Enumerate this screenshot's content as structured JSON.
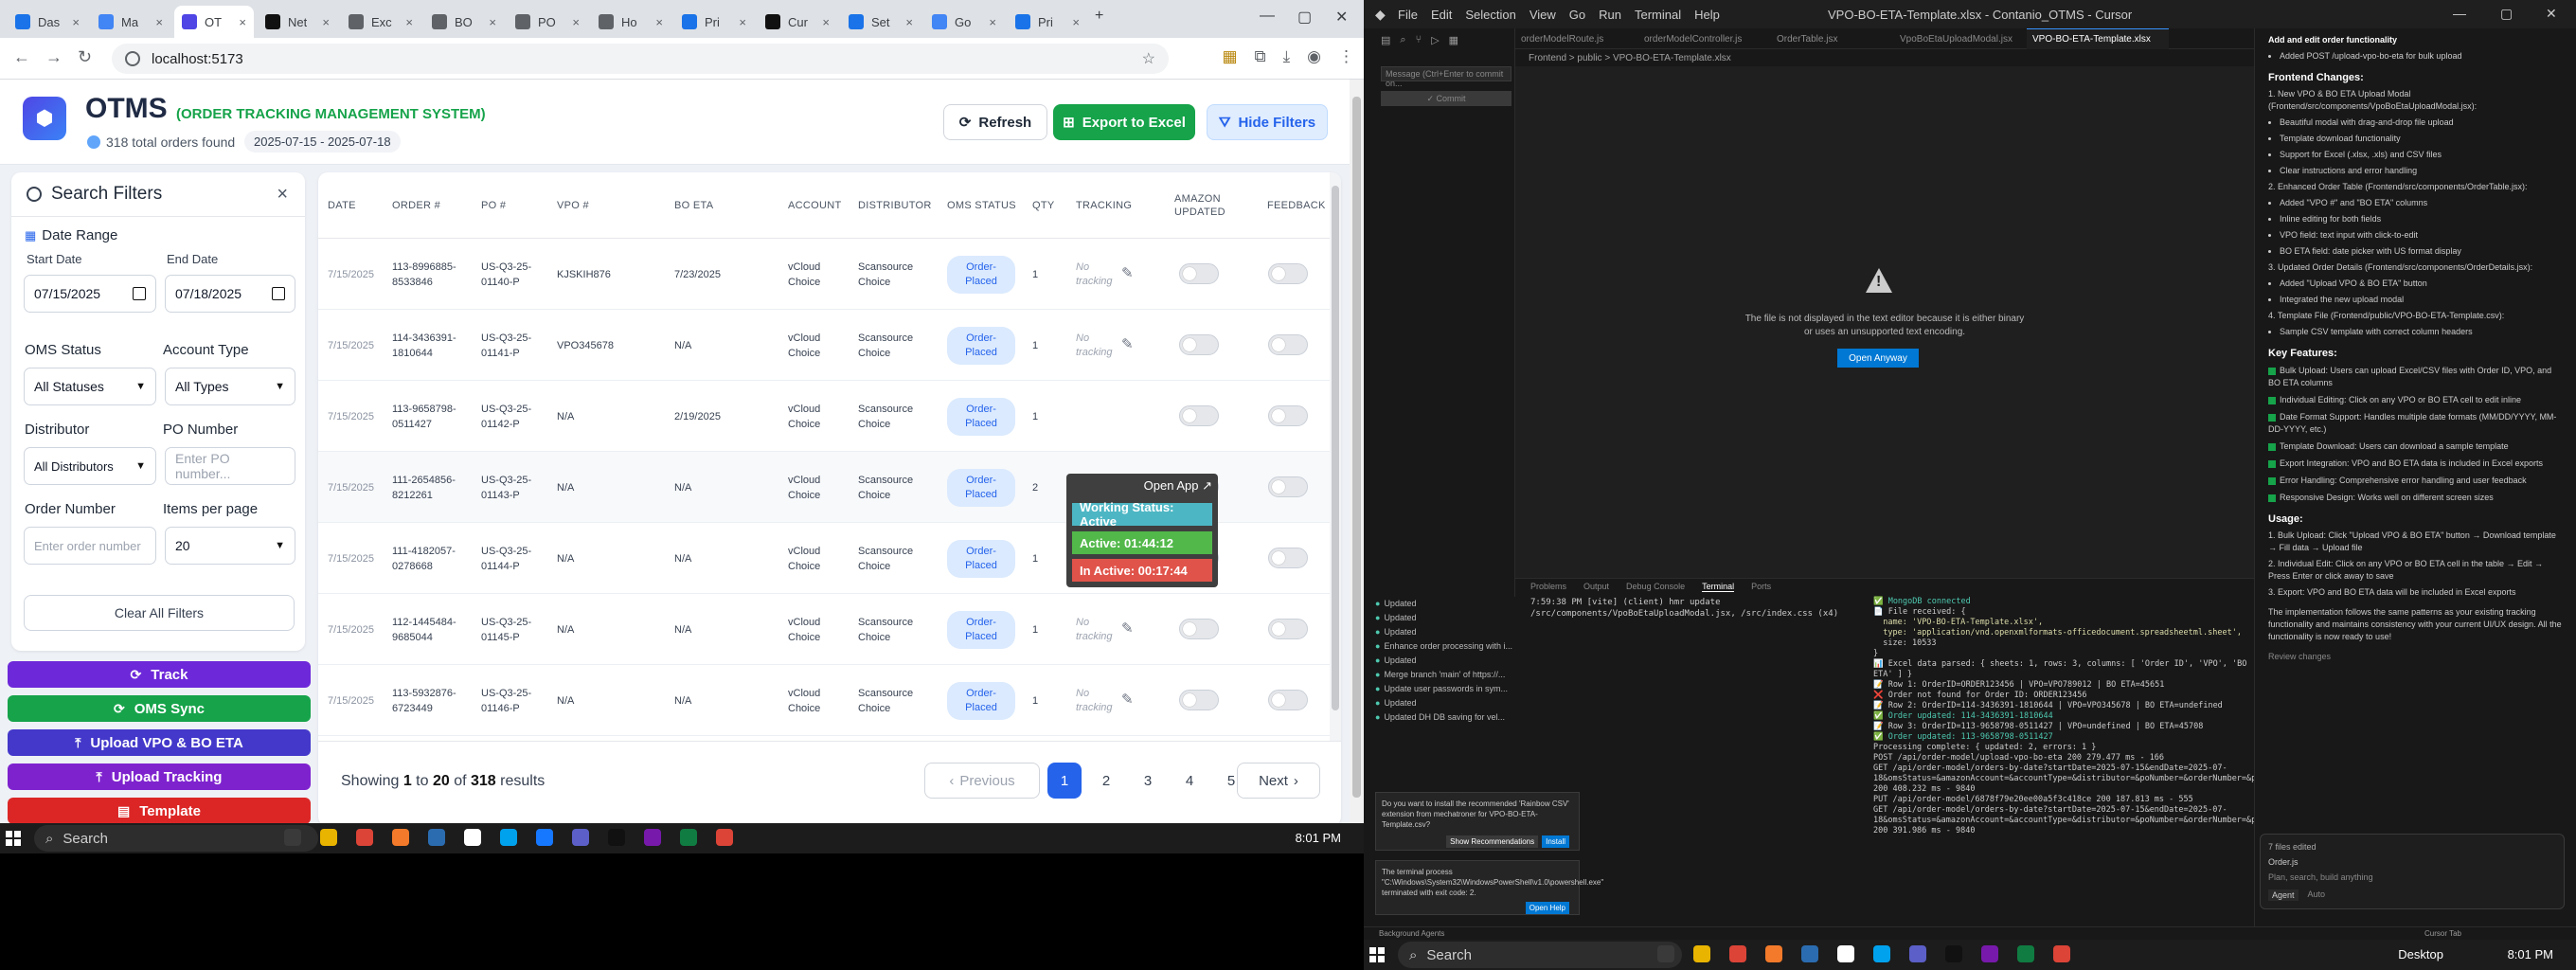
{
  "browser": {
    "tabs": [
      {
        "label": "Das",
        "color": "#1a73e8"
      },
      {
        "label": "Ma",
        "color": "#4285f4"
      },
      {
        "label": "OT",
        "color": "#4f46e5"
      },
      {
        "label": "Net",
        "color": "#111111"
      },
      {
        "label": "Exc",
        "color": "#5f6368"
      },
      {
        "label": "BO",
        "color": "#5f6368"
      },
      {
        "label": "PO",
        "color": "#5f6368"
      },
      {
        "label": "Ho",
        "color": "#5f6368"
      },
      {
        "label": "Pri",
        "color": "#1a73e8"
      },
      {
        "label": "Cur",
        "color": "#111111"
      },
      {
        "label": "Set",
        "color": "#1a73e8"
      },
      {
        "label": "Go",
        "color": "#4285f4"
      },
      {
        "label": "Pri",
        "color": "#1a73e8"
      }
    ],
    "url": "localhost:5173"
  },
  "header": {
    "title": "OTMS",
    "subtitle": "(ORDER TRACKING MANAGEMENT SYSTEM)",
    "orders_found": "318 total orders found",
    "date_range": "2025-07-15 - 2025-07-18",
    "refresh": "Refresh",
    "export": "Export to Excel",
    "hide_filters": "Hide Filters"
  },
  "filters": {
    "title": "Search Filters",
    "date_range": "Date Range",
    "start_label": "Start Date",
    "end_label": "End Date",
    "start_value": "07/15/2025",
    "end_value": "07/18/2025",
    "oms_status_label": "OMS Status",
    "oms_status_value": "All Statuses",
    "account_type_label": "Account Type",
    "account_type_value": "All Types",
    "distributor_label": "Distributor",
    "distributor_value": "All Distributors",
    "po_label": "PO Number",
    "po_placeholder": "Enter PO number...",
    "order_label": "Order Number",
    "order_placeholder": "Enter order number",
    "ipp_label": "Items per page",
    "ipp_value": "20",
    "clear": "Clear All Filters"
  },
  "actions": [
    {
      "label": "Track",
      "color": "#6d28d9",
      "icon": "refresh-icon"
    },
    {
      "label": "OMS Sync",
      "color": "#16a34a",
      "icon": "refresh-icon"
    },
    {
      "label": "Upload VPO & BO ETA",
      "color": "#4338ca",
      "icon": "upload-icon"
    },
    {
      "label": "Upload Tracking",
      "color": "#7e22ce",
      "icon": "upload-icon"
    },
    {
      "label": "Template",
      "color": "#dc2626",
      "icon": "file-icon"
    }
  ],
  "table": {
    "columns": [
      "DATE",
      "ORDER #",
      "PO #",
      "VPO #",
      "BO ETA",
      "ACCOUNT",
      "DISTRIBUTOR",
      "OMS STATUS",
      "QTY",
      "TRACKING",
      "AMAZON UPDATED",
      "FEEDBACK"
    ],
    "rows": [
      {
        "date": "7/15/2025",
        "order": "113-8996885-8533846",
        "po": "US-Q3-25-01140-P",
        "vpo": "KJSKIH876",
        "bo_eta": "7/23/2025",
        "account": "vCloud Choice",
        "distributor": "Scansource Choice",
        "status": "Order-Placed",
        "qty": "1",
        "tracking": "No tracking"
      },
      {
        "date": "7/15/2025",
        "order": "114-3436391-1810644",
        "po": "US-Q3-25-01141-P",
        "vpo": "VPO345678",
        "bo_eta": "N/A",
        "account": "vCloud Choice",
        "distributor": "Scansource Choice",
        "status": "Order-Placed",
        "qty": "1",
        "tracking": "No tracking"
      },
      {
        "date": "7/15/2025",
        "order": "113-9658798-0511427",
        "po": "US-Q3-25-01142-P",
        "vpo": "N/A",
        "bo_eta": "2/19/2025",
        "account": "vCloud Choice",
        "distributor": "Scansource Choice",
        "status": "Order-Placed",
        "qty": "1",
        "tracking": ""
      },
      {
        "date": "7/15/2025",
        "order": "111-2654856-8212261",
        "po": "US-Q3-25-01143-P",
        "vpo": "N/A",
        "bo_eta": "N/A",
        "account": "vCloud Choice",
        "distributor": "Scansource Choice",
        "status": "Order-Placed",
        "qty": "2",
        "tracking": ""
      },
      {
        "date": "7/15/2025",
        "order": "111-4182057-0278668",
        "po": "US-Q3-25-01144-P",
        "vpo": "N/A",
        "bo_eta": "N/A",
        "account": "vCloud Choice",
        "distributor": "Scansource Choice",
        "status": "Order-Placed",
        "qty": "1",
        "tracking": "No tracking"
      },
      {
        "date": "7/15/2025",
        "order": "112-1445484-9685044",
        "po": "US-Q3-25-01145-P",
        "vpo": "N/A",
        "bo_eta": "N/A",
        "account": "vCloud Choice",
        "distributor": "Scansource Choice",
        "status": "Order-Placed",
        "qty": "1",
        "tracking": "No tracking"
      },
      {
        "date": "7/15/2025",
        "order": "113-5932876-6723449",
        "po": "US-Q3-25-01146-P",
        "vpo": "N/A",
        "bo_eta": "N/A",
        "account": "vCloud Choice",
        "distributor": "Scansource Choice",
        "status": "Order-Placed",
        "qty": "1",
        "tracking": "No tracking"
      }
    ],
    "showing_prefix": "Showing ",
    "showing_from": "1",
    "showing_to_word": " to ",
    "showing_to": "20",
    "showing_of_word": " of ",
    "showing_total": "318",
    "showing_suffix": " results",
    "prev": "Previous",
    "next": "Next",
    "pages": [
      "1",
      "2",
      "3",
      "4",
      "5"
    ]
  },
  "widget": {
    "open_app": "Open App ↗",
    "working": "Working Status: Active",
    "active": "Active: 01:44:12",
    "inactive": "In Active: 00:17:44"
  },
  "taskbar": {
    "search": "Search",
    "time": "8:01 PM",
    "desktop": "Desktop"
  },
  "vscode": {
    "title": "VPO-BO-ETA-Template.xlsx - Contanio_OTMS - Cursor",
    "menu": [
      "File",
      "Edit",
      "Selection",
      "View",
      "Go",
      "Run",
      "Terminal",
      "Help"
    ],
    "tabs": [
      "orderModelRoute.js",
      "orderModelController.js",
      "OrderTable.jsx",
      "VpoBoEtaUploadModal.jsx",
      "VPO-BO-ETA-Template.xlsx"
    ],
    "breadcrumb": "Frontend > public > VPO-BO-ETA-Template.xlsx",
    "binary_msg": "The file is not displayed in the text editor because it is either binary or uses an unsupported text encoding.",
    "open_anyway": "Open Anyway",
    "message_placeholder": "Message (Ctrl+Enter to commit on...",
    "commit": "✓ Commit",
    "panel_tabs": [
      "Problems",
      "Output",
      "Debug Console",
      "Terminal",
      "Ports"
    ],
    "term_left": "7:59:38 PM [vite] (client) hmr update /src/components/VpoBoEtaUploadModal.jsx, /src/index.css (x4)",
    "term_right": [
      {
        "t": "✅ MongoDB connected",
        "c": "g"
      },
      {
        "t": "📄 File received: {",
        "c": ""
      },
      {
        "t": "  name: 'VPO-BO-ETA-Template.xlsx',",
        "c": "y"
      },
      {
        "t": "  type: 'application/vnd.openxmlformats-officedocument.spreadsheetml.sheet',",
        "c": "y"
      },
      {
        "t": "  size: 10533",
        "c": ""
      },
      {
        "t": "}",
        "c": ""
      },
      {
        "t": "📊 Excel data parsed: { sheets: 1, rows: 3, columns: [ 'Order ID', 'VPO', 'BO ETA' ] }",
        "c": ""
      },
      {
        "t": "📝 Row 1: OrderID=ORDER123456 | VPO=VPO789012 | BO ETA=45651",
        "c": ""
      },
      {
        "t": "❌ Order not found for Order ID: ORDER123456",
        "c": ""
      },
      {
        "t": "📝 Row 2: OrderID=114-3436391-1810644 | VPO=VPO345678 | BO ETA=undefined",
        "c": ""
      },
      {
        "t": "✅ Order updated: 114-3436391-1810644",
        "c": "g"
      },
      {
        "t": "📝 Row 3: OrderID=113-9658798-0511427 | VPO=undefined | BO ETA=45708",
        "c": ""
      },
      {
        "t": "✅ Order updated: 113-9658798-0511427",
        "c": "g"
      },
      {
        "t": "Processing complete: { updated: 2, errors: 1 }",
        "c": ""
      },
      {
        "t": "POST /api/order-model/upload-vpo-bo-eta 200 279.477 ms - 166",
        "c": ""
      },
      {
        "t": "GET /api/order-model/orders-by-date?startDate=2025-07-15&endDate=2025-07-18&omsStatus=&amazonAccount=&accountType=&distributor=&poNumber=&orderNumber=&page=1&limit=20 200 408.232 ms - 9840",
        "c": ""
      },
      {
        "t": "PUT /api/order-model/6878f79e20ee00a5f3c418ce 200 187.813 ms - 555",
        "c": ""
      },
      {
        "t": "GET /api/order-model/orders-by-date?startDate=2025-07-15&endDate=2025-07-18&omsStatus=&amazonAccount=&accountType=&distributor=&poNumber=&orderNumber=&page=1&limit=20 200 391.986 ms - 9840",
        "c": ""
      }
    ],
    "scm": [
      "Updated",
      "Updated",
      "Updated",
      "Enhance order processing with i...",
      "Updated",
      "Merge branch 'main' of https://...",
      "Update user passwords in sym...",
      "Updated",
      "Updated DH DB saving for vel..."
    ],
    "notif1": "Do you want to install the recommended 'Rainbow CSV' extension from mechatroner for VPO-BO-ETA-Template.csv?",
    "notif1_btns": [
      "Show Recommendations",
      "Install"
    ],
    "notif2": "The terminal process \"C:\\Windows\\System32\\WindowsPowerShell\\v1.0\\powershell.exe\" terminated with exit code: 2.",
    "notif2_btn": "Open Help",
    "agent": {
      "header": "Add and edit order functionality",
      "top_item": "Added POST /upload-vpo-bo-eta for bulk upload",
      "frontend_title": "Frontend Changes:",
      "fc": [
        {
          "title": "New VPO & BO ETA Upload Modal (Frontend/src/components/VpoBoEtaUploadModal.jsx):",
          "items": [
            "Beautiful modal with drag-and-drop file upload",
            "Template download functionality",
            "Support for Excel (.xlsx, .xls) and CSV files",
            "Clear instructions and error handling"
          ]
        },
        {
          "title": "Enhanced Order Table (Frontend/src/components/OrderTable.jsx):",
          "items": [
            "Added \"VPO #\" and \"BO ETA\" columns",
            "Inline editing for both fields",
            "VPO field: text input with click-to-edit",
            "BO ETA field: date picker with US format display"
          ]
        },
        {
          "title": "Updated Order Details (Frontend/src/components/OrderDetails.jsx):",
          "items": [
            "Added \"Upload VPO & BO ETA\" button",
            "Integrated the new upload modal"
          ]
        },
        {
          "title": "Template File (Frontend/public/VPO-BO-ETA-Template.csv):",
          "items": [
            "Sample CSV template with correct column headers"
          ]
        }
      ],
      "key_title": "Key Features:",
      "key": [
        "Bulk Upload: Users can upload Excel/CSV files with Order ID, VPO, and BO ETA columns",
        "Individual Editing: Click on any VPO or BO ETA cell to edit inline",
        "Date Format Support: Handles multiple date formats (MM/DD/YYYY, MM-DD-YYYY, etc.)",
        "Template Download: Users can download a sample template",
        "Export Integration: VPO and BO ETA data is included in Excel exports",
        "Error Handling: Comprehensive error handling and user feedback",
        "Responsive Design: Works well on different screen sizes"
      ],
      "usage_title": "Usage:",
      "usage": [
        "Bulk Upload: Click \"Upload VPO & BO ETA\" button → Download template → Fill data → Upload file",
        "Individual Edit: Click on any VPO or BO ETA cell in the table → Edit → Press Enter or click away to save",
        "Export: VPO and BO ETA data will be included in Excel exports"
      ],
      "summary": "The implementation follows the same patterns as your existing tracking functionality and maintains consistency with your current UI/UX design. All the functionality is now ready to use!",
      "review": "Review changes",
      "files": "7 files edited",
      "ctx_file": "Order.js",
      "input_placeholder": "Plan, search, build anything",
      "mode": "Agent",
      "model": "Auto"
    },
    "status_left": "Background Agents",
    "status_right": "Cursor Tab"
  }
}
